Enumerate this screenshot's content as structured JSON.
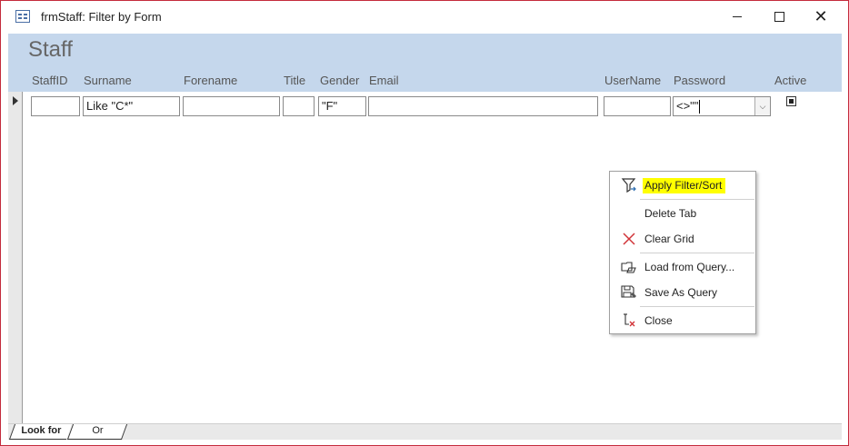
{
  "window": {
    "title": "frmStaff: Filter by Form",
    "minimize_glyph": "",
    "maximize_glyph": "",
    "close_glyph": "✕"
  },
  "form": {
    "title": "Staff",
    "columns": [
      "StaffID",
      "Surname",
      "Forename",
      "Title",
      "Gender",
      "Email",
      "UserName",
      "Password",
      "Active"
    ]
  },
  "criteria": {
    "staffid": "",
    "surname": "Like \"C*\"",
    "forename": "",
    "title": "",
    "gender": "\"F\"",
    "email": "",
    "username": "",
    "password": "<>\"\""
  },
  "tabs": {
    "look_for": "Look for",
    "or": "Or"
  },
  "context_menu": {
    "items": [
      {
        "label": "Apply Filter/Sort",
        "icon": "funnel-icon",
        "highlighted": true
      },
      {
        "label": "Delete Tab",
        "icon": "",
        "highlighted": false
      },
      {
        "label": "Clear Grid",
        "icon": "red-x-icon",
        "highlighted": false
      },
      {
        "label": "Load from Query...",
        "icon": "load-query-icon",
        "highlighted": false
      },
      {
        "label": "Save As Query",
        "icon": "save-query-icon",
        "highlighted": false
      },
      {
        "label": "Close",
        "icon": "close-doc-icon",
        "highlighted": false
      }
    ],
    "highlight_color": "#ffff00"
  },
  "colors": {
    "header_band": "#c5d7ec",
    "window_border": "#c42b3c"
  }
}
